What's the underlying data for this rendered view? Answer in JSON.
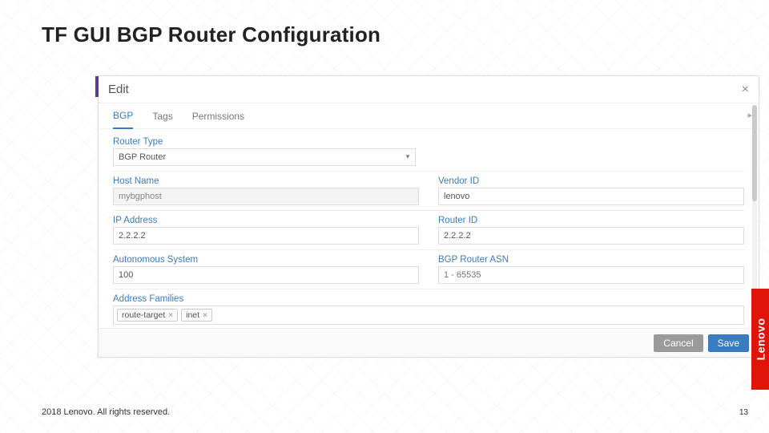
{
  "slide": {
    "title": "TF GUI BGP Router Configuration",
    "footer": "2018 Lenovo. All rights reserved.",
    "page": "13",
    "brand": "Lenovo"
  },
  "modal": {
    "title": "Edit",
    "tabs": [
      "BGP",
      "Tags",
      "Permissions"
    ],
    "active_tab": 0,
    "buttons": {
      "cancel": "Cancel",
      "save": "Save"
    }
  },
  "form": {
    "router_type": {
      "label": "Router Type",
      "value": "BGP Router"
    },
    "host_name": {
      "label": "Host Name",
      "value": "mybgphost"
    },
    "vendor_id": {
      "label": "Vendor ID",
      "value": "lenovo"
    },
    "ip_address": {
      "label": "IP Address",
      "value": "2.2.2.2"
    },
    "router_id": {
      "label": "Router ID",
      "value": "2.2.2.2"
    },
    "asn": {
      "label": "Autonomous System",
      "value": "100"
    },
    "bgp_asn": {
      "label": "BGP Router ASN",
      "placeholder": "1 - 65535"
    },
    "addr_fam": {
      "label": "Address Families",
      "tags": [
        "route-target",
        "inet"
      ]
    }
  }
}
